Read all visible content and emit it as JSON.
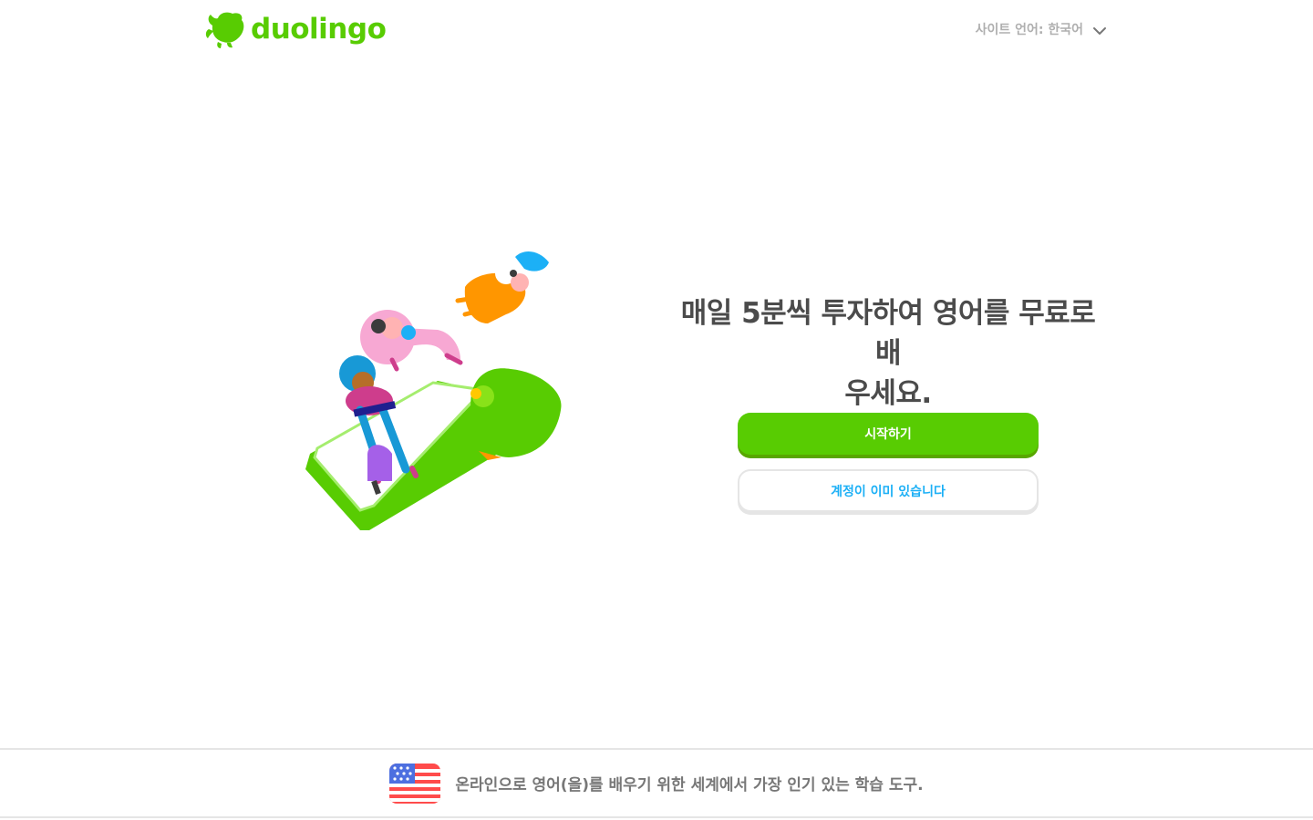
{
  "header": {
    "logo_text": "duolingo",
    "site_language_label": "사이트 언어: 한국어"
  },
  "hero": {
    "headline_line1": "매일 5분씩 투자하여 영어를 무료로 배",
    "headline_line2": "우세요.",
    "get_started_label": "시작하기",
    "have_account_label": "계정이 이미 있습니다"
  },
  "footer": {
    "flag_icon": "us-flag-icon",
    "tagline": "온라인으로 영어(을)를 배우기 위한 세계에서 가장 인기 있는 학습 도구."
  },
  "colors": {
    "brand_green": "#58cc02",
    "brand_green_shadow": "#58a700",
    "link_blue": "#1cb0f6",
    "text_dark": "#4b4b4b",
    "text_muted": "#afafaf",
    "border": "#e5e5e5"
  }
}
